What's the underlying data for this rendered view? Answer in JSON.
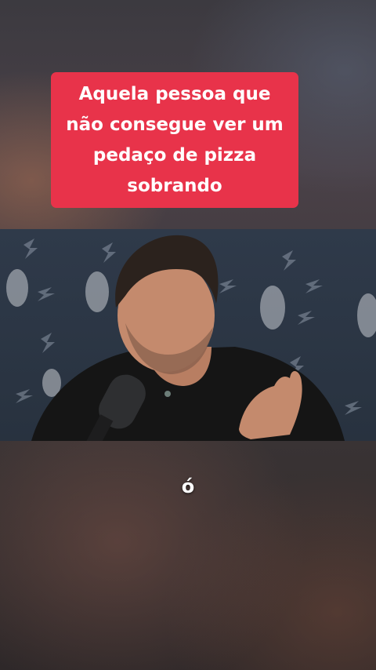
{
  "caption": {
    "text": "Aquela pessoa que não consegue ver um pedaço de pizza sobrando"
  },
  "video": {
    "subtitle": "ó"
  },
  "colors": {
    "caption_background": "#e8334a",
    "caption_text": "#ffffff"
  }
}
